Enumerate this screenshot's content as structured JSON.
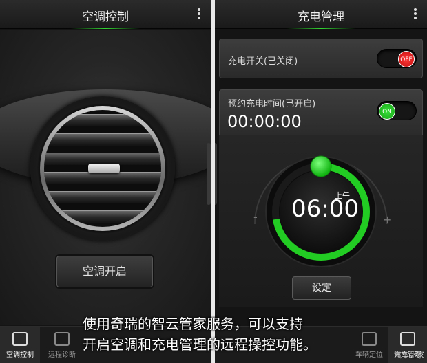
{
  "left_screen": {
    "title": "空调控制",
    "ac_button_label": "空调开启",
    "nav": [
      {
        "label": "空调控制",
        "icon": "climate-icon",
        "active": true
      },
      {
        "label": "远程诊断",
        "icon": "diagnosis-icon",
        "active": false
      },
      {
        "label": "车辆定位",
        "icon": "location-icon",
        "active": false
      },
      {
        "label": "充电管理",
        "icon": "charge-icon",
        "active": false
      }
    ]
  },
  "right_screen": {
    "title": "充电管理",
    "charge_switch_label": "充电开关(已关闭)",
    "charge_switch_state": "OFF",
    "schedule_label": "预约充电时间(已开启)",
    "schedule_switch_state": "ON",
    "schedule_time": "00:00:00",
    "dial_ampm": "上午",
    "dial_time": "06:00",
    "dial_minus": "-",
    "dial_plus": "+",
    "set_button_label": "设定",
    "nav": [
      {
        "label": "空调控制",
        "icon": "climate-icon",
        "active": false
      },
      {
        "label": "远程诊断",
        "icon": "diagnosis-icon",
        "active": false
      },
      {
        "label": "车辆定位",
        "icon": "location-icon",
        "active": false
      },
      {
        "label": "充电管理",
        "icon": "charge-icon",
        "active": true
      }
    ]
  },
  "caption": {
    "line1": "使用奇瑞的智云管家服务，可以支持",
    "line2": "开启空调和充电管理的远程操控功能。"
  },
  "watermark": "汽车之家",
  "colors": {
    "accent_green": "#22cc22",
    "off_red": "#e01818",
    "background": "#141414"
  }
}
